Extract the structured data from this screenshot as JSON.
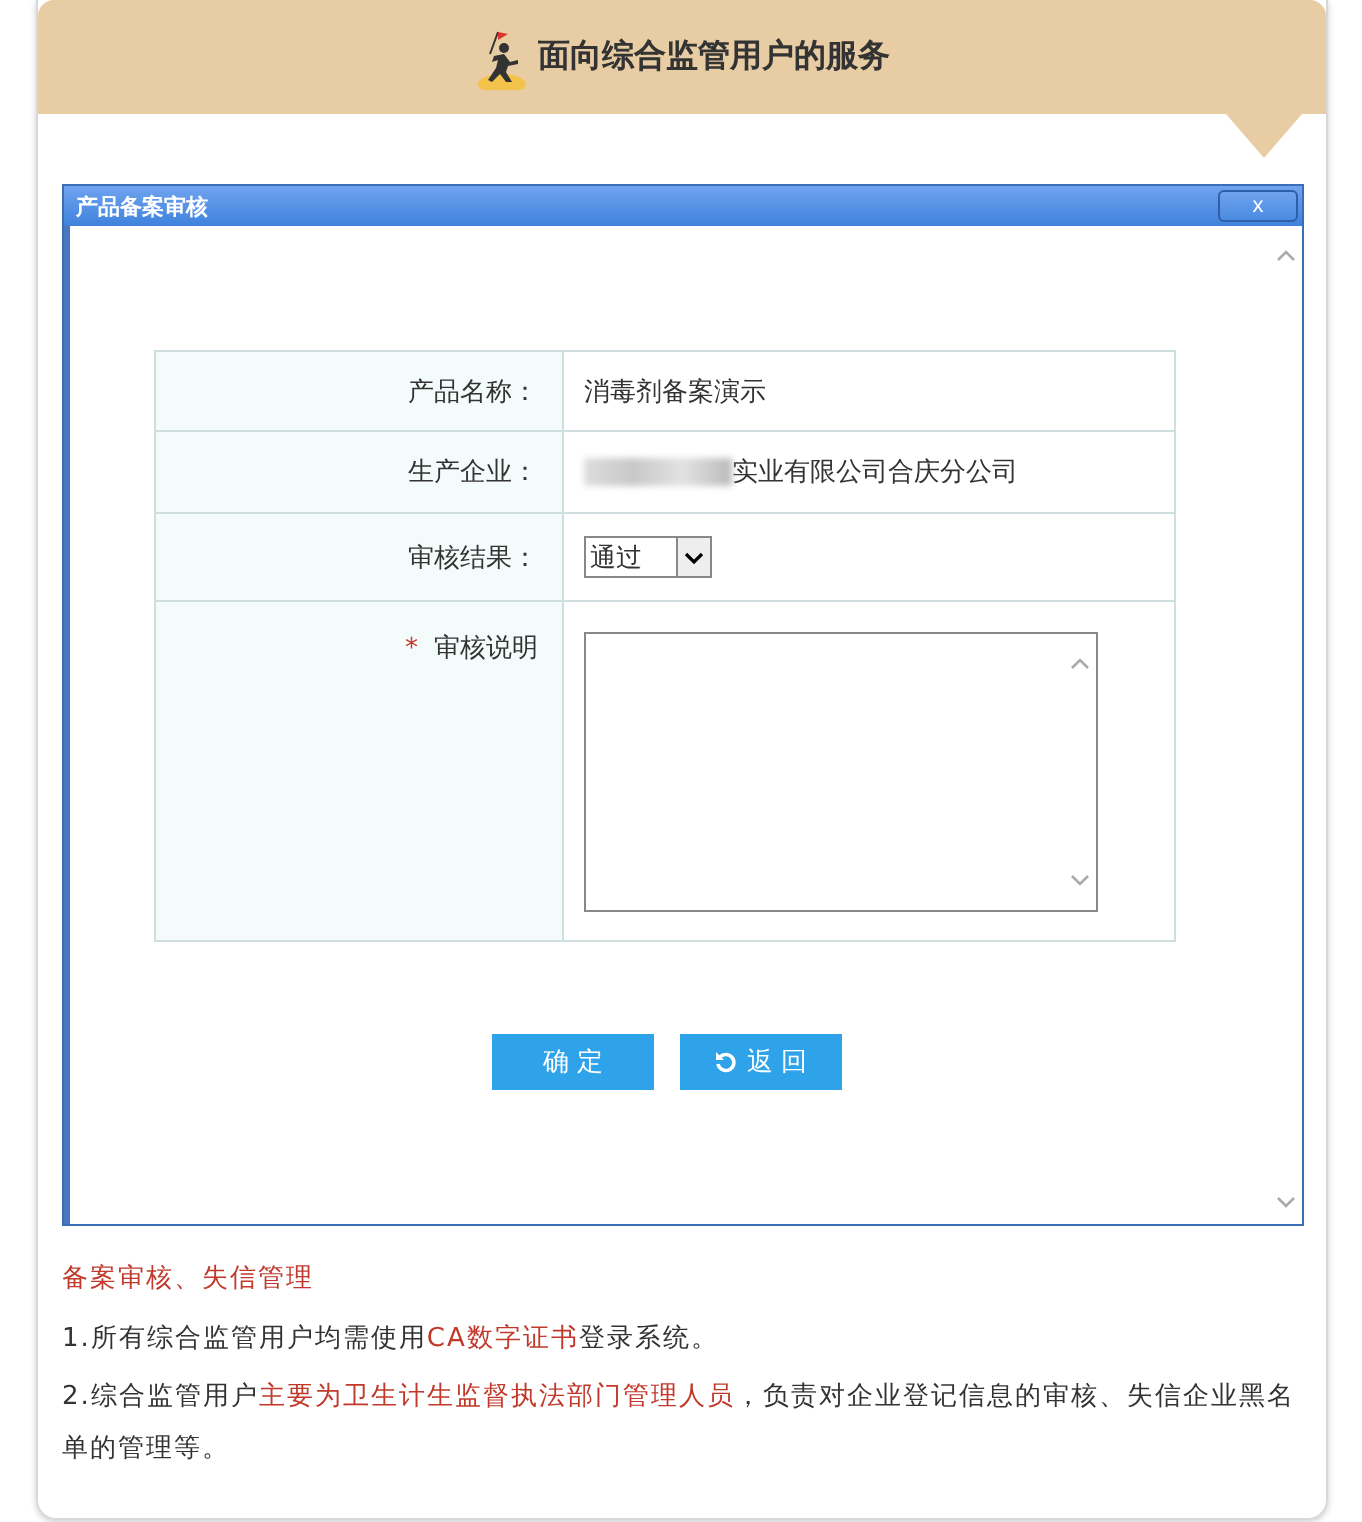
{
  "header": {
    "title": "面向综合监管用户的服务"
  },
  "dialog": {
    "title": "产品备案审核",
    "close_label": "x",
    "fields": [
      {
        "kind": "text",
        "label": "产品名称：",
        "value": "消毒剂备案演示"
      },
      {
        "kind": "redacted",
        "label": "生产企业：",
        "value": "实业有限公司合庆分公司"
      },
      {
        "kind": "select",
        "label": "审核结果：",
        "value": "通过"
      },
      {
        "kind": "textarea",
        "label": "审核说明",
        "required_mark": "*"
      }
    ],
    "buttons": [
      {
        "kind": "confirm",
        "label": "确 定"
      },
      {
        "kind": "back",
        "label": "返 回"
      }
    ]
  },
  "notes": {
    "heading": "备案审核、失信管理",
    "paragraphs": [
      [
        {
          "text": "1.所有综合监管用户均需使用",
          "highlight": false
        },
        {
          "text": "CA数字证书",
          "highlight": true
        },
        {
          "text": "登录系统。",
          "highlight": false
        }
      ],
      [
        {
          "text": "2.综合监管用户",
          "highlight": false
        },
        {
          "text": "主要为卫生计生监督执法部门管理人员",
          "highlight": true
        },
        {
          "text": "，负责对企业登记信息的审核、失信企业黑名单的管理等。",
          "highlight": false
        }
      ]
    ]
  }
}
